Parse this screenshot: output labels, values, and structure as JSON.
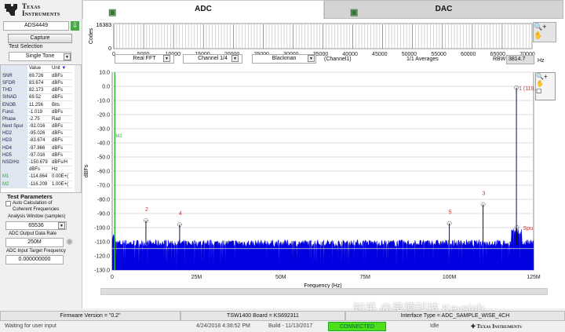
{
  "brand": {
    "line1": "Texas",
    "line2": "Instruments"
  },
  "left": {
    "device": "ADS4449",
    "capture": "Capture",
    "test_selection_label": "Test Selection",
    "test_selection": "Single Tone",
    "table_headers": {
      "value": "Value",
      "unit": "Unit"
    },
    "rows": [
      {
        "name": "SNR",
        "value": "69.726",
        "unit": "dBFs"
      },
      {
        "name": "SFDR",
        "value": "83.674",
        "unit": "dBFs"
      },
      {
        "name": "THD",
        "value": "82.173",
        "unit": "dBFs"
      },
      {
        "name": "SINAD",
        "value": "69.52",
        "unit": "dBFs"
      },
      {
        "name": "ENOB",
        "value": "11.256",
        "unit": "Bits"
      },
      {
        "name": "Fund.",
        "value": "-1.019",
        "unit": "dBFs"
      },
      {
        "name": "Phase",
        "value": "-2.75",
        "unit": "Rad"
      },
      {
        "name": "Next Spur",
        "value": "-92.016",
        "unit": "dBFs"
      },
      {
        "name": "HD2",
        "value": "-95.026",
        "unit": "dBFs"
      },
      {
        "name": "HD3",
        "value": "-83.674",
        "unit": "dBFs"
      },
      {
        "name": "HD4",
        "value": "-97.866",
        "unit": "dBFs"
      },
      {
        "name": "HD5",
        "value": "-97.016",
        "unit": "dBFs"
      },
      {
        "name": "NSD/Hz",
        "value": "-150.679",
        "unit": "dBFs/H"
      },
      {
        "name": "",
        "value": "dBFs",
        "unit": "Hz"
      },
      {
        "name": "M1",
        "value": "-114.864",
        "unit": "0.00E+("
      },
      {
        "name": "M2",
        "value": "-116.209",
        "unit": "1.00E+("
      }
    ],
    "test_params": "Test Parameters",
    "auto_calc": "Auto Calculation of Coherent Frequencies",
    "window_label": "Analysis Window (samples)",
    "window": "65536",
    "rate_label": "ADC Output Data Rate",
    "rate": "250M",
    "target_label": "ADC Input Target Frequency",
    "target": "0.000000000"
  },
  "tabs": [
    {
      "label": "ADC"
    },
    {
      "label": "DAC"
    }
  ],
  "codes": {
    "ylabel": "Codes",
    "ymax": "16383",
    "ymin": "0",
    "ticks": [
      "0",
      "5000",
      "10000",
      "15000",
      "20000",
      "25000",
      "30000",
      "35000",
      "40000",
      "45000",
      "50000",
      "55000",
      "60000",
      "65000",
      "70000"
    ]
  },
  "controls": {
    "fft": "Real FFT",
    "channel": "Channel 1/4",
    "window": "Blackman",
    "channel_note": "(Channel1)",
    "averages": "1/1 Averages",
    "rbw_label": "RBW",
    "rbw": "3814.7",
    "rbw_unit": "Hz"
  },
  "chart_data": {
    "type": "line",
    "xlabel": "Frequency (Hz)",
    "ylabel": "dBFs",
    "ylim": [
      -130,
      10
    ],
    "xlim": [
      0,
      125000000
    ],
    "yticks": [
      "10.0",
      "0.0",
      "-10.0",
      "-20.0",
      "-30.0",
      "-40.0",
      "-50.0",
      "-60.0",
      "-70.0",
      "-80.0",
      "-90.0",
      "-100.0",
      "-110.0",
      "-120.0",
      "-130.0"
    ],
    "xticks": [
      "0",
      "25M",
      "50M",
      "75M",
      "100M",
      "125M"
    ],
    "grid": true,
    "noise_floor_dbfs": -111,
    "color": "#0000e0",
    "peaks": [
      {
        "label": "1 (119.9",
        "x": 119900000,
        "y": -1.019
      },
      {
        "label": "2",
        "x": 10000000,
        "y": -95.026
      },
      {
        "label": "3",
        "x": 110000000,
        "y": -83.674
      },
      {
        "label": "4",
        "x": 20000000,
        "y": -97.866
      },
      {
        "label": "5",
        "x": 100000000,
        "y": -97.016
      },
      {
        "label": "Spu",
        "x": 120000000,
        "y": -100
      }
    ],
    "markers": [
      {
        "label": "M2",
        "x": 1000000
      }
    ],
    "marker_line_y": -114.864
  },
  "status": {
    "firmware": "Firmware Version = \"0.2\"",
    "board": "TSW1400 Board = KS692311",
    "interface": "Interface Type = ADC_SAMPLE_WISE_4CH",
    "msg": "Waiting for user input",
    "date": "4/24/2018 4:38:52 PM",
    "build": "Build - 11/13/2017",
    "conn": "CONNECTED",
    "idle": "Idle",
    "watermark": "知乎 @是德科技 Keysigh..."
  }
}
